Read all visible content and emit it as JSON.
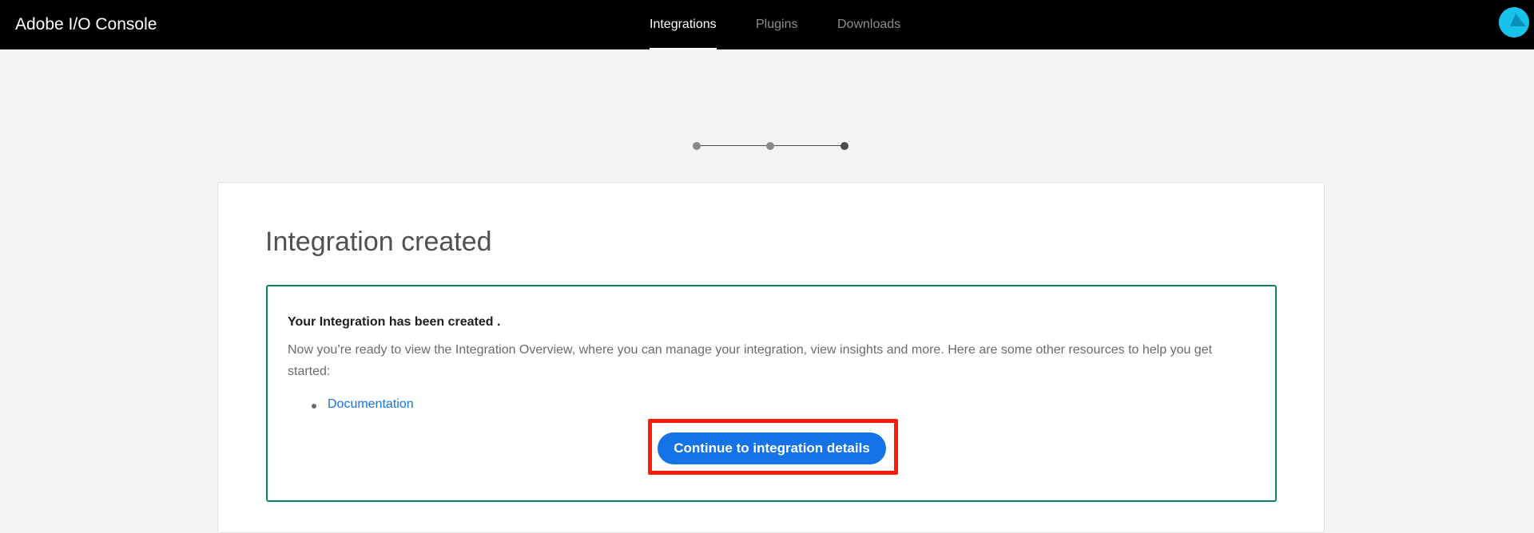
{
  "header": {
    "app_title": "Adobe I/O Console",
    "tabs": [
      {
        "label": "Integrations",
        "active": true
      },
      {
        "label": "Plugins",
        "active": false
      },
      {
        "label": "Downloads",
        "active": false
      }
    ],
    "background_color": "#000000",
    "avatar_color": "#16c2e9"
  },
  "stepper": {
    "total_steps": 3,
    "current_step": 3,
    "completed_color": "#888888",
    "current_color": "#4b4b4b"
  },
  "main": {
    "title": "Integration created",
    "success": {
      "heading": "Your Integration has been created .",
      "body": "Now you’re ready to view the Integration Overview, where you can manage your integration, view insights and more. Here are some other resources to help you get started:",
      "resources": [
        {
          "label": "Documentation"
        }
      ],
      "border_color": "#0d8555"
    },
    "continue_button": {
      "label": "Continue to integration details",
      "color": "#1473e6",
      "highlight_color": "#ff1a00"
    }
  }
}
